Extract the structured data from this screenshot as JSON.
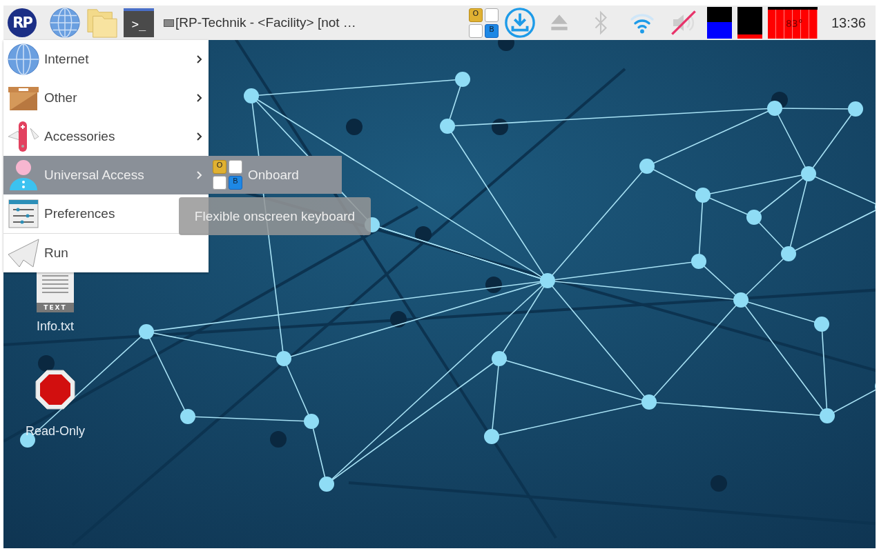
{
  "panel": {
    "launchers": [
      {
        "kind": "logo",
        "label": "RP"
      },
      {
        "kind": "globe"
      },
      {
        "kind": "folder"
      },
      {
        "kind": "terminal",
        "label": ">_"
      }
    ],
    "task": "[RP-Technik - <Facility> [not …",
    "keyboard": {
      "keys": [
        "O",
        "B"
      ]
    },
    "volume": {
      "muted": true
    },
    "meters": [
      {
        "color": "#0000ff",
        "level": 0.52
      },
      {
        "color": "#ff0000",
        "level": 0.13
      }
    ],
    "temperature": {
      "reading": "83°"
    },
    "clock": "13:36"
  },
  "menu": {
    "items": [
      {
        "kind": "globe",
        "label": "Internet",
        "submenu": true,
        "selected": false
      },
      {
        "kind": "box",
        "label": "Other",
        "submenu": true,
        "selected": false
      },
      {
        "kind": "knife",
        "label": "Accessories",
        "submenu": true,
        "selected": false
      },
      {
        "kind": "person",
        "label": "Universal Access",
        "submenu": true,
        "selected": true
      },
      {
        "kind": "sliders",
        "label": "Preferences",
        "submenu": false,
        "selected": false
      },
      {
        "kind": "plane",
        "label": "Run",
        "submenu": false,
        "selected": false
      }
    ],
    "submenu": [
      {
        "label": "Onboard",
        "keys": [
          "O",
          "B"
        ]
      }
    ],
    "tooltip": "Flexible onscreen keyboard"
  },
  "desktop_icons": [
    {
      "kind": "text-file",
      "badge": "TEXT",
      "label": "Info.txt"
    },
    {
      "kind": "stop",
      "label": "Read-Only"
    }
  ]
}
